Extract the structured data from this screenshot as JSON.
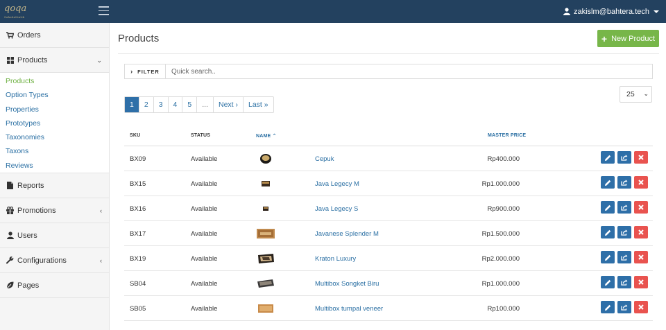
{
  "brand": {
    "logo_text": "qoqa",
    "logo_sub": "Sahabatbatik"
  },
  "header": {
    "user_email": "zakislm@bahtera.tech"
  },
  "sidebar": {
    "items": [
      {
        "key": "orders",
        "label": "Orders",
        "icon": "cart-icon"
      },
      {
        "key": "products",
        "label": "Products",
        "icon": "grid-icon",
        "expanded": true
      },
      {
        "key": "reports",
        "label": "Reports",
        "icon": "file-icon"
      },
      {
        "key": "promotions",
        "label": "Promotions",
        "icon": "gift-icon"
      },
      {
        "key": "users",
        "label": "Users",
        "icon": "user-icon"
      },
      {
        "key": "configurations",
        "label": "Configurations",
        "icon": "wrench-icon"
      },
      {
        "key": "pages",
        "label": "Pages",
        "icon": "leaf-icon"
      }
    ],
    "products_sub": [
      "Products",
      "Option Types",
      "Properties",
      "Prototypes",
      "Taxonomies",
      "Taxons",
      "Reviews"
    ]
  },
  "main": {
    "title": "Products",
    "new_button": "New Product",
    "filter": {
      "label": "FILTER",
      "placeholder": "Quick search.."
    },
    "pagination": [
      "1",
      "2",
      "3",
      "4",
      "5",
      "...",
      "Next ›",
      "Last »"
    ],
    "active_page": "1",
    "per_page": "25",
    "columns": {
      "sku": "SKU",
      "status": "STATUS",
      "name": "NAME",
      "price": "MASTER PRICE"
    },
    "rows": [
      {
        "sku": "BX09",
        "status": "Available",
        "name": "Cepuk",
        "price": "Rp400.000"
      },
      {
        "sku": "BX15",
        "status": "Available",
        "name": "Java Legecy M",
        "price": "Rp1.000.000"
      },
      {
        "sku": "BX16",
        "status": "Available",
        "name": "Java Legecy S",
        "price": "Rp900.000"
      },
      {
        "sku": "BX17",
        "status": "Available",
        "name": "Javanese Splender M",
        "price": "Rp1.500.000"
      },
      {
        "sku": "BX19",
        "status": "Available",
        "name": "Kraton Luxury",
        "price": "Rp2.000.000"
      },
      {
        "sku": "SB04",
        "status": "Available",
        "name": "Multibox Songket Biru",
        "price": "Rp1.000.000"
      },
      {
        "sku": "SB05",
        "status": "Available",
        "name": "Multibox tumpal veneer",
        "price": "Rp100.000"
      }
    ]
  },
  "colors": {
    "topbar": "#23415f",
    "accent_green": "#77b649",
    "primary_blue": "#2e6fa8",
    "danger_red": "#e9534f",
    "link": "#2a6fa3"
  }
}
